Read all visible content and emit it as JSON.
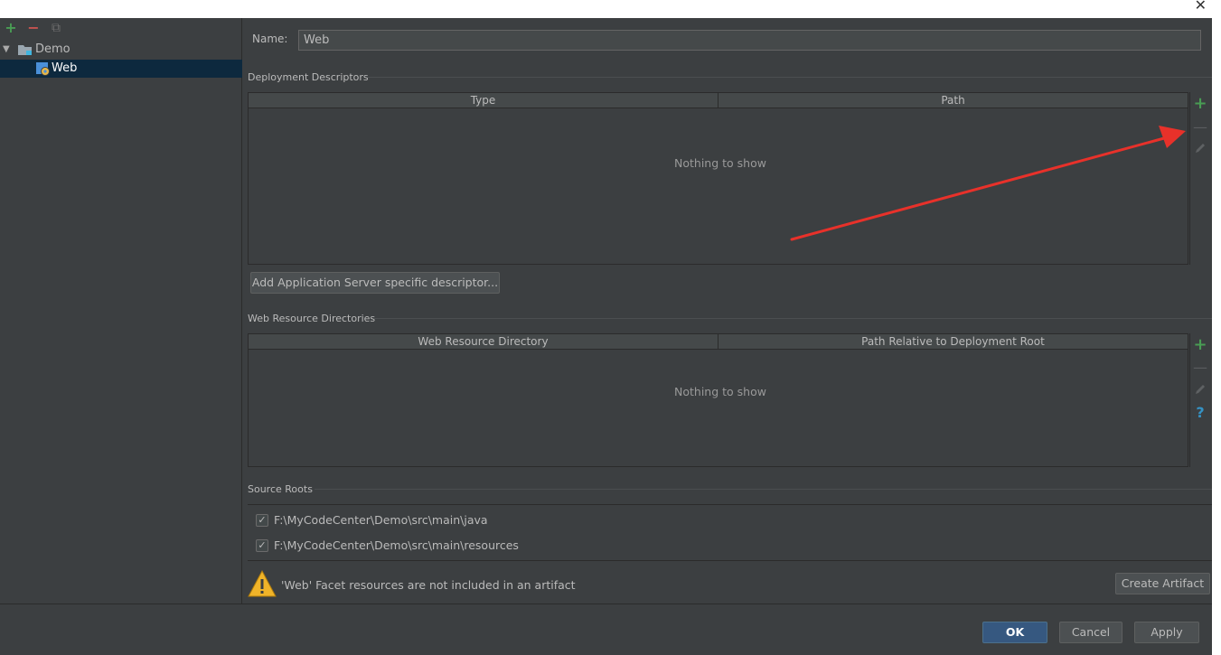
{
  "left": {
    "toolbar": {
      "add": "+",
      "remove": "−",
      "copy": "⧉"
    },
    "tree": [
      {
        "label": "Demo",
        "expanded_glyph": "▼"
      },
      {
        "label": "Web"
      }
    ]
  },
  "name": {
    "label": "Name:",
    "value": "Web"
  },
  "deployment": {
    "title": "Deployment Descriptors",
    "columns": [
      "Type",
      "Path"
    ],
    "empty": "Nothing to show",
    "add_button": "Add Application Server specific descriptor..."
  },
  "web_resources": {
    "title": "Web Resource Directories",
    "columns": [
      "Web Resource Directory",
      "Path Relative to Deployment Root"
    ],
    "empty": "Nothing to show",
    "help_glyph": "?"
  },
  "source_roots": {
    "title": "Source Roots",
    "items": [
      {
        "path": "F:\\MyCodeCenter\\Demo\\src\\main\\java",
        "checked": true
      },
      {
        "path": "F:\\MyCodeCenter\\Demo\\src\\main\\resources",
        "checked": true
      }
    ]
  },
  "warning": {
    "text": "'Web' Facet resources are not included in an artifact",
    "button": "Create Artifact"
  },
  "footer": {
    "ok": "OK",
    "cancel": "Cancel",
    "apply": "Apply"
  },
  "window": {
    "close_glyph": "✕"
  },
  "colors": {
    "accent_green": "#499c54",
    "remove_red": "#c75450",
    "annotation_arrow": "#e8312a",
    "selection": "#0d293e",
    "primary_button": "#365880"
  }
}
